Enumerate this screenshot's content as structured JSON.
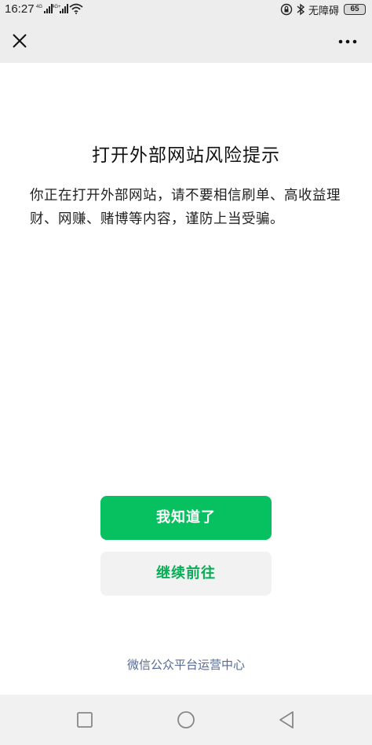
{
  "status_bar": {
    "time": "16:27",
    "signal1_label": "4G",
    "signal2_label": "4G+",
    "accessibility_text": "无障碍",
    "battery": "65"
  },
  "nav": {
    "close_icon": "close-icon",
    "more_icon": "more-dots-icon"
  },
  "dialog": {
    "title": "打开外部网站风险提示",
    "message": "你正在打开外部网站，请不要相信刷单、高收益理财、网赚、赌博等内容，谨防上当受骗。",
    "primary_button": "我知道了",
    "secondary_button": "继续前往"
  },
  "footer": {
    "link": "微信公众平台运营中心"
  },
  "colors": {
    "primary": "#07c160",
    "secondary_text": "#06ae56",
    "link": "#576b95"
  }
}
